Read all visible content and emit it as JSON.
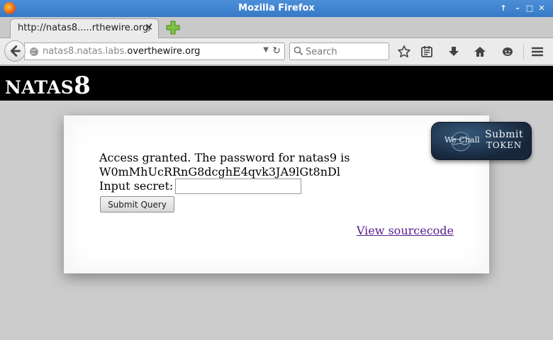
{
  "window": {
    "title": "Mozilla Firefox",
    "controls": {
      "up": "↑",
      "minimize": "–",
      "maximize": "□",
      "close": "✕"
    }
  },
  "tabs": [
    {
      "label": "http://natas8.....rthewire.org/",
      "close": "✕"
    }
  ],
  "urlbar": {
    "prefix": "natas8.natas.labs.",
    "host": "overthewire.org"
  },
  "search": {
    "placeholder": "Search"
  },
  "toolbar_icons": [
    "bookmark-star-icon",
    "reading-list-icon",
    "download-icon",
    "home-icon",
    "chat-icon",
    "menu-icon"
  ],
  "page": {
    "brand": "NATAS",
    "brand_num": "8",
    "message_line1": "Access granted. The password for natas9 is",
    "message_line2": "W0mMhUcRRnG8dcghE4qvk3JA9lGt8nDl",
    "input_label": "Input secret:",
    "input_value": "",
    "submit_label": "Submit Query",
    "source_link": "View sourcecode",
    "wechall": {
      "logo_text": "We Chall",
      "submit": "Submit",
      "token": "TOKEN"
    }
  },
  "colors": {
    "titlebar": "#3679c6",
    "header_bg": "#000000",
    "page_bg": "#cccccc",
    "link_visited": "#551a8b"
  }
}
